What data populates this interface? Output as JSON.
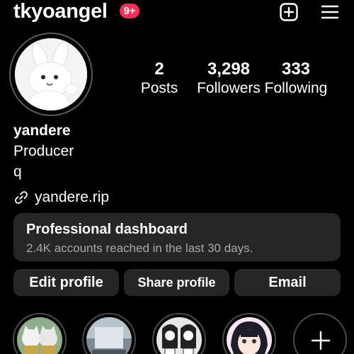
{
  "header": {
    "username": "tkyoangel",
    "notification_badge": "9+",
    "new_post_icon": "plus-square-icon",
    "menu_icon": "hamburger-menu-icon",
    "badge_color": "#ff2d55"
  },
  "profile": {
    "avatar_icon": "white-bunny-avatar",
    "stats": {
      "posts": {
        "value": "2",
        "label": "Posts"
      },
      "followers": {
        "value": "3,298",
        "label": "Followers"
      },
      "following": {
        "value": "333",
        "label": "Following"
      }
    },
    "name": "yandere",
    "bio_lines": [
      "Producer",
      "q"
    ],
    "link_icon": "link-icon",
    "link_text": "yandere.rip"
  },
  "dashboard": {
    "title": "Professional dashboard",
    "subtitle": "2.4K accounts reached in the last 30 days."
  },
  "actions": {
    "edit_profile": "Edit profile",
    "share_profile": "Share profile",
    "email": "Email"
  },
  "highlights": {
    "items": [
      "highlight-cats",
      "highlight-photo",
      "highlight-manga-girls",
      "highlight-anime-girl"
    ],
    "add_icon": "plus-icon"
  },
  "colors": {
    "background": "#000000",
    "card": "#262626",
    "secondary_text": "#a8a8a8"
  }
}
